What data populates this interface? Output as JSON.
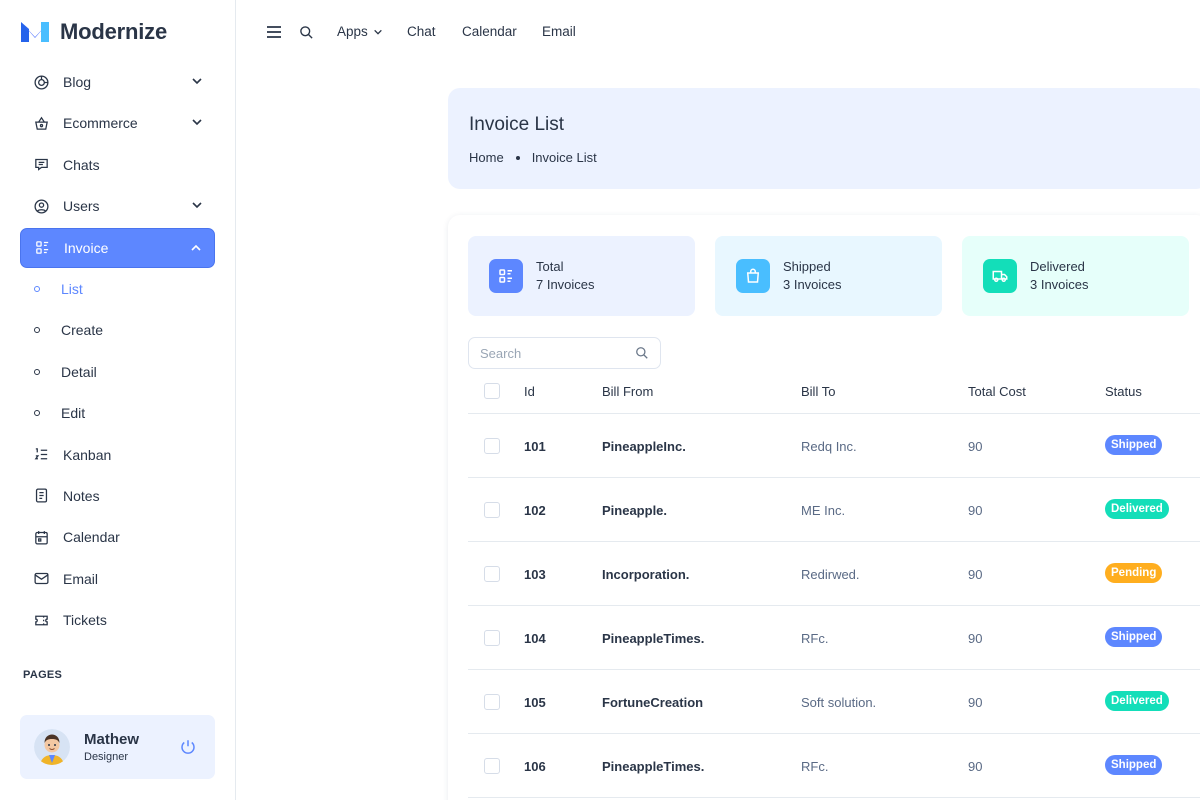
{
  "brand": {
    "name": "Modernize"
  },
  "sidebar": {
    "items": [
      {
        "label": "Blog"
      },
      {
        "label": "Ecommerce"
      },
      {
        "label": "Chats"
      },
      {
        "label": "Users"
      },
      {
        "label": "Invoice"
      },
      {
        "label": "List"
      },
      {
        "label": "Create"
      },
      {
        "label": "Detail"
      },
      {
        "label": "Edit"
      },
      {
        "label": "Kanban"
      },
      {
        "label": "Notes"
      },
      {
        "label": "Calendar"
      },
      {
        "label": "Email"
      },
      {
        "label": "Tickets"
      }
    ],
    "section_title": "PAGES",
    "profile": {
      "name": "Mathew",
      "role": "Designer"
    }
  },
  "topbar": {
    "links": [
      "Apps",
      "Chat",
      "Calendar",
      "Email"
    ]
  },
  "page": {
    "title": "Invoice List",
    "breadcrumb": [
      "Home",
      "Invoice List"
    ]
  },
  "stats": [
    {
      "label": "Total",
      "value": "7 Invoices",
      "color": "#5d87ff",
      "bg": "#ecf2ff"
    },
    {
      "label": "Shipped",
      "value": "3 Invoices",
      "color": "#49beff",
      "bg": "#e8f7ff"
    },
    {
      "label": "Delivered",
      "value": "3 Invoices",
      "color": "#13deb9",
      "bg": "#e6fffa"
    }
  ],
  "search": {
    "placeholder": "Search"
  },
  "table": {
    "headers": [
      "Id",
      "Bill From",
      "Bill To",
      "Total Cost",
      "Status"
    ],
    "rows": [
      {
        "id": "101",
        "from": "PineappleInc.",
        "to": "Redq Inc.",
        "cost": "90",
        "status": "Shipped"
      },
      {
        "id": "102",
        "from": "Pineapple.",
        "to": "ME Inc.",
        "cost": "90",
        "status": "Delivered"
      },
      {
        "id": "103",
        "from": "Incorporation.",
        "to": "Redirwed.",
        "cost": "90",
        "status": "Pending"
      },
      {
        "id": "104",
        "from": "PineappleTimes.",
        "to": "RFc.",
        "cost": "90",
        "status": "Shipped"
      },
      {
        "id": "105",
        "from": "FortuneCreation",
        "to": "Soft solution.",
        "cost": "90",
        "status": "Delivered"
      },
      {
        "id": "106",
        "from": "PineappleTimes.",
        "to": "RFc.",
        "cost": "90",
        "status": "Shipped"
      }
    ]
  },
  "status_colors": {
    "Shipped": "#5d87ff",
    "Delivered": "#13deb9",
    "Pending": "#ffae1f"
  }
}
